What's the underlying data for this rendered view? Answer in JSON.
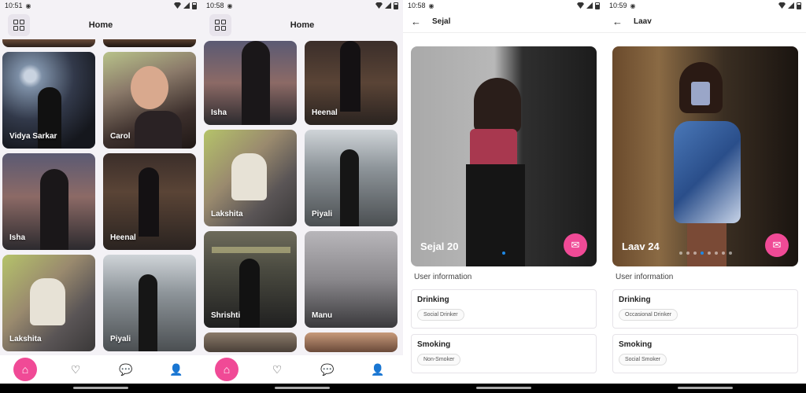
{
  "screens": [
    {
      "time": "10:51",
      "title": "Home",
      "tiles": [
        {
          "name": "Vidya Sarkar"
        },
        {
          "name": "Carol"
        },
        {
          "name": "Isha"
        },
        {
          "name": "Heenal"
        },
        {
          "name": "Lakshita"
        },
        {
          "name": "Piyali"
        }
      ]
    },
    {
      "time": "10:58",
      "title": "Home",
      "tiles": [
        {
          "name": "Isha"
        },
        {
          "name": "Heenal"
        },
        {
          "name": "Lakshita"
        },
        {
          "name": "Piyali"
        },
        {
          "name": "Shrishti"
        },
        {
          "name": "Manu"
        }
      ]
    },
    {
      "time": "10:58",
      "header_name": "Sejal",
      "photo_caption": "Sejal 20",
      "section_title": "User information",
      "cards": [
        {
          "title": "Drinking",
          "chip": "Social Drinker"
        },
        {
          "title": "Smoking",
          "chip": "Non-Smoker"
        }
      ]
    },
    {
      "time": "10:59",
      "header_name": "Laav",
      "photo_caption": "Laav 24",
      "section_title": "User information",
      "cards": [
        {
          "title": "Drinking",
          "chip": "Occasional Drinker"
        },
        {
          "title": "Smoking",
          "chip": "Social Smoker"
        }
      ]
    }
  ],
  "icons": {
    "grid": "grid-icon",
    "home": "home-icon",
    "heart": "heart-icon",
    "chat": "chat-icon",
    "profile": "profile-icon",
    "back": "back-arrow-icon",
    "message": "message-icon"
  },
  "colors": {
    "accent": "#f04a96",
    "dot_active": "#1e88e5"
  }
}
